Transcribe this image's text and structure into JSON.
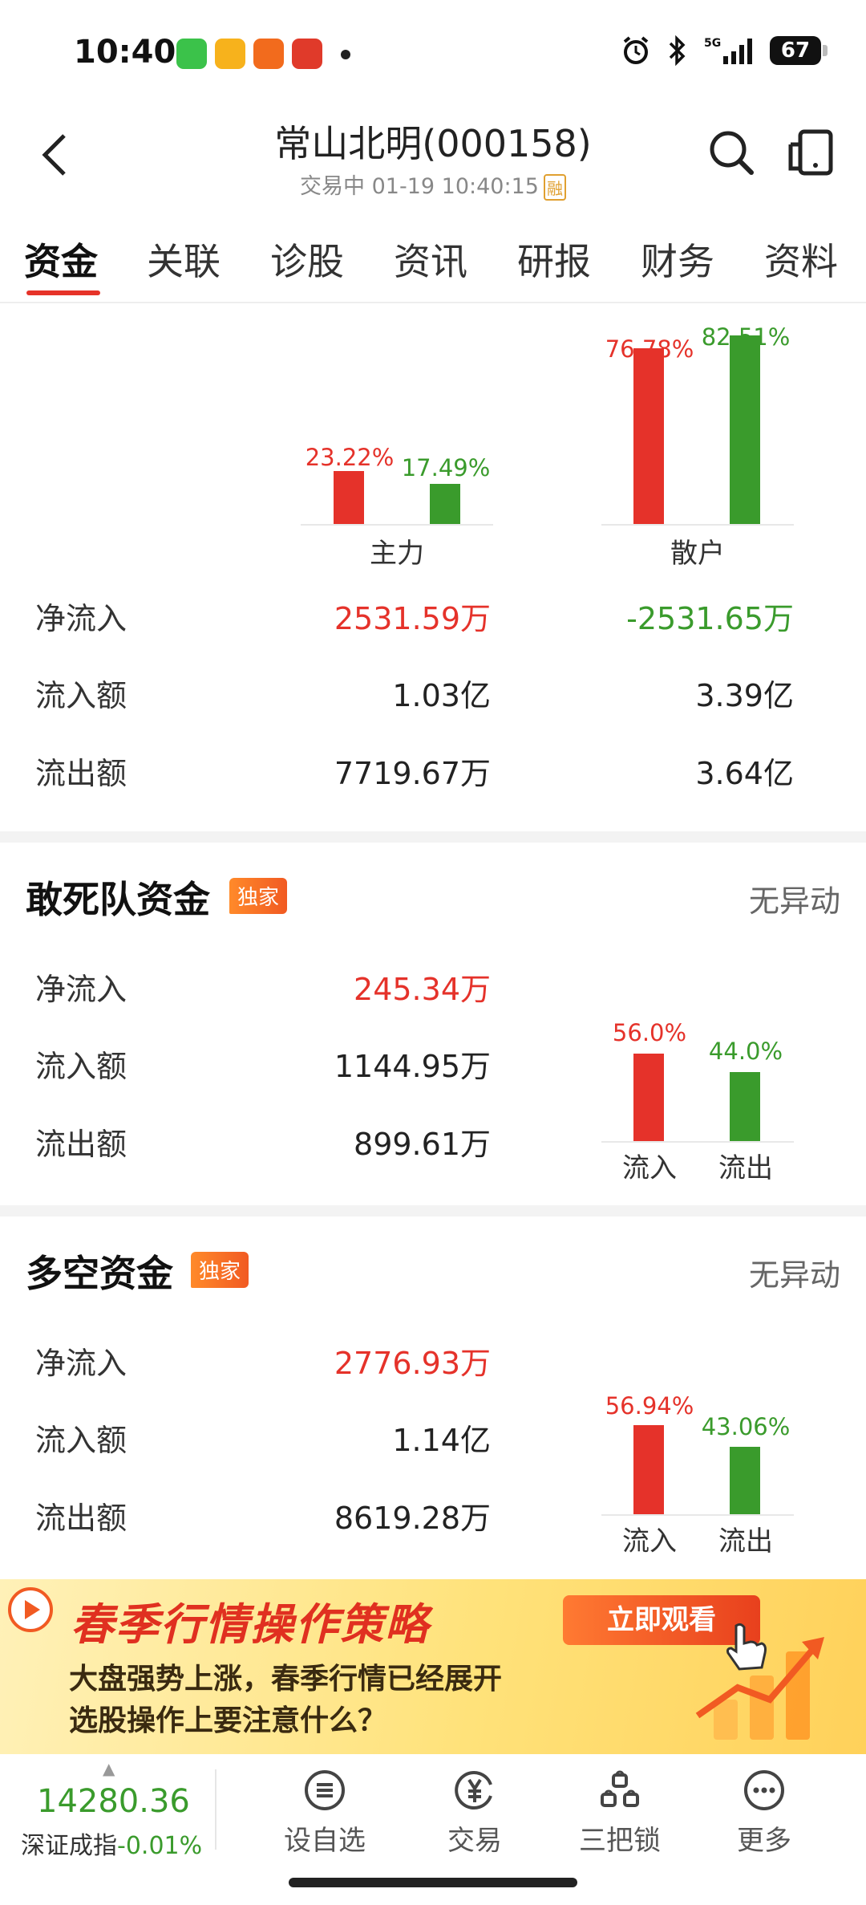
{
  "status_bar": {
    "time": "10:40",
    "battery": "67"
  },
  "header": {
    "title": "常山北明(000158)",
    "subtitle": "交易中 01-19 10:40:15",
    "rong_badge": "融"
  },
  "tabs": [
    "资金",
    "关联",
    "诊股",
    "资讯",
    "研报",
    "财务",
    "资料"
  ],
  "overview": {
    "main_force": {
      "label": "主力",
      "inflow_pct": "23.22%",
      "outflow_pct": "17.49%",
      "inflow_ratio": 0.2322,
      "outflow_ratio": 0.1749
    },
    "retail": {
      "label": "散户",
      "inflow_pct": "76.78%",
      "outflow_pct": "82.51%",
      "inflow_ratio": 0.7678,
      "outflow_ratio": 0.8251
    },
    "rows": [
      {
        "label": "净流入",
        "main": "2531.59万",
        "retail": "-2531.65万"
      },
      {
        "label": "流入额",
        "main": "1.03亿",
        "retail": "3.39亿"
      },
      {
        "label": "流出额",
        "main": "7719.67万",
        "retail": "3.64亿"
      }
    ]
  },
  "dare_squad": {
    "title": "敢死队资金",
    "badge": "独家",
    "status": "无异动",
    "rows": [
      {
        "label": "净流入",
        "value": "245.34万"
      },
      {
        "label": "流入额",
        "value": "1144.95万"
      },
      {
        "label": "流出额",
        "value": "899.61万"
      }
    ],
    "inflow_pct": "56.0%",
    "outflow_pct": "44.0%",
    "inflow_label": "流入",
    "outflow_label": "流出"
  },
  "long_short": {
    "title": "多空资金",
    "badge": "独家",
    "status": "无异动",
    "rows": [
      {
        "label": "净流入",
        "value": "2776.93万"
      },
      {
        "label": "流入额",
        "value": "1.14亿"
      },
      {
        "label": "流出额",
        "value": "8619.28万"
      }
    ],
    "inflow_pct": "56.94%",
    "outflow_pct": "43.06%",
    "inflow_label": "流入",
    "outflow_label": "流出"
  },
  "ad": {
    "title": "春季行情操作策略",
    "button": "立即观看",
    "line1": "大盘强势上涨，春季行情已经展开",
    "line2": "选股操作上要注意什么？"
  },
  "bottom": {
    "index_value": "14280.36",
    "index_name": "深证成指",
    "index_change": "-0.01%",
    "nav": [
      "设自选",
      "交易",
      "三把锁",
      "更多"
    ]
  },
  "colors": {
    "up": "#e5322a",
    "down": "#3a9b2c",
    "accent": "#e63329"
  }
}
